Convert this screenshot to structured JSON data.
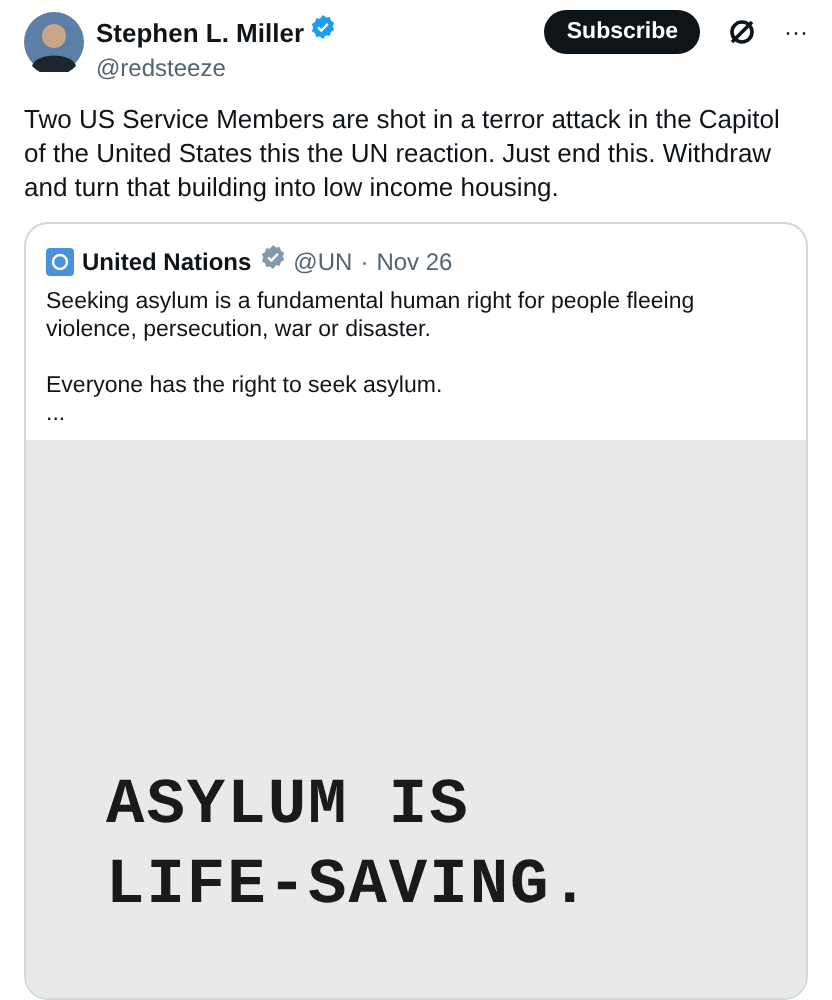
{
  "author": {
    "name": "Stephen L. Miller",
    "verified": true,
    "handle": "@redsteeze"
  },
  "actions": {
    "subscribe": "Subscribe",
    "more": "···"
  },
  "text": "Two US Service Members are shot in a terror attack in the Capitol of the United States this the UN reaction.  Just end this. Withdraw and turn that building into low income housing.",
  "quote": {
    "name": "United Nations",
    "verified": true,
    "handle": "@UN",
    "separator": "·",
    "date": "Nov 26",
    "paragraphs": [
      "Seeking asylum is a fundamental human right for people fleeing violence, persecution, war or disaster.",
      "Everyone has the right to seek asylum.",
      "..."
    ],
    "media": {
      "lines": [
        "ASYLUM IS",
        "LIFE-SAVING."
      ]
    }
  }
}
